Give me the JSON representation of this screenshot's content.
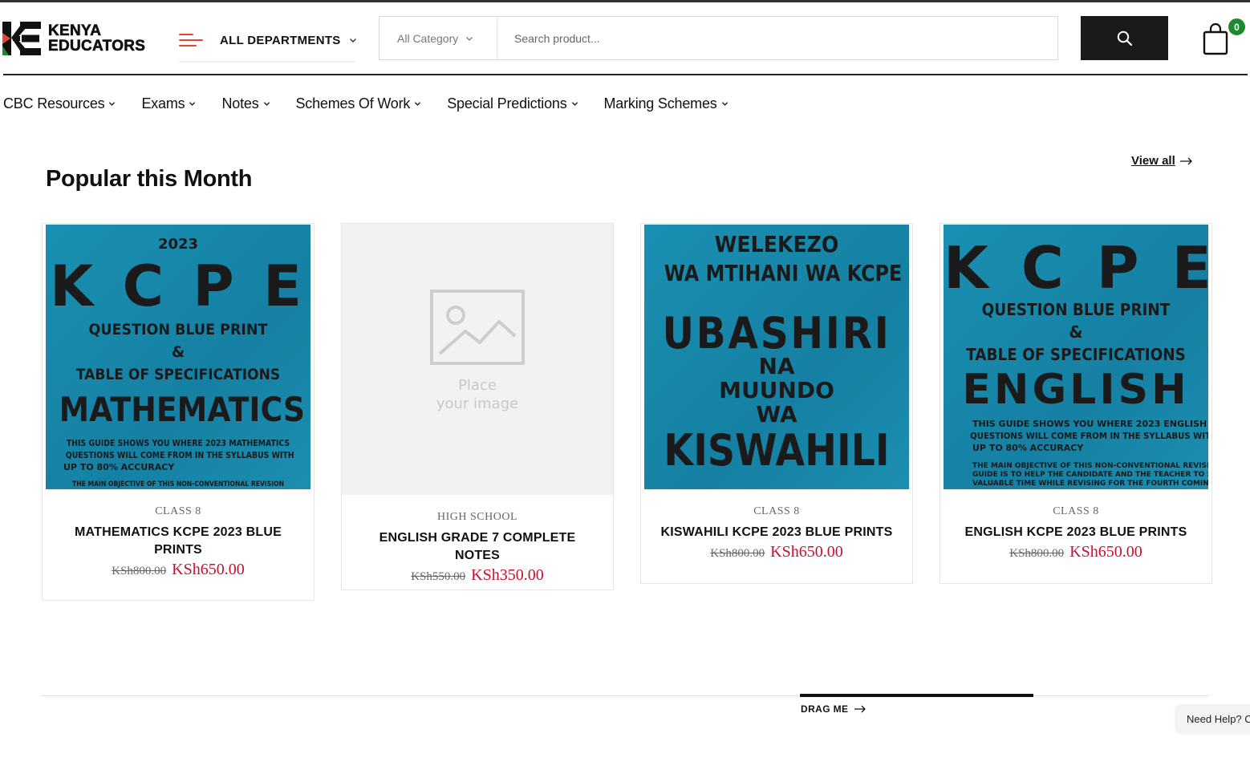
{
  "brand": {
    "name_line1": "KENYA",
    "name_line2": "EDUCATORS",
    "accent_red": "#e0492f",
    "accent_green": "#1e8a2e"
  },
  "header": {
    "departments_label": "ALL DEPARTMENTS",
    "search": {
      "category_label": "All Category",
      "placeholder": "Search product...",
      "value": ""
    },
    "cart_count": "0"
  },
  "nav": {
    "items": [
      {
        "label": "CBC Resources"
      },
      {
        "label": "Exams"
      },
      {
        "label": "Notes"
      },
      {
        "label": "Schemes Of Work"
      },
      {
        "label": "Special Predictions"
      },
      {
        "label": "Marking Schemes"
      }
    ]
  },
  "section": {
    "title": "Popular this Month",
    "view_all": "View all"
  },
  "products": [
    {
      "category": "CLASS 8",
      "title": "MATHEMATICS KCPE 2023 BLUE PRINTS",
      "old_price": "KSh800.00",
      "new_price": "KSh650.00",
      "cover": {
        "year": "2023",
        "big": "K C P E",
        "line1": "QUESTION BLUE PRINT",
        "amp": "&",
        "line2": "TABLE OF SPECIFICATIONS",
        "subject": "MATHEMATICS",
        "blurb1": "THIS GUIDE SHOWS YOU WHERE 2023 MATHEMATICS",
        "blurb2": "QUESTIONS WILL COME FROM IN THE SYLLABUS WITH",
        "blurb3": "UP TO 80% ACCURACY",
        "blurb4": "THE MAIN OBJECTIVE OF THIS NON-CONVENTIONAL REVISION"
      }
    },
    {
      "category": "HIGH SCHOOL",
      "title": "ENGLISH GRADE 7 COMPLETE NOTES",
      "old_price": "KSh550.00",
      "new_price": "KSh350.00",
      "placeholder_line1": "Place",
      "placeholder_line2": "your image"
    },
    {
      "category": "CLASS 8",
      "title": "KISWAHILI KCPE 2023 BLUE PRINTS",
      "old_price": "KSh800.00",
      "new_price": "KSh650.00",
      "cover": {
        "line1": "WELEKEZO",
        "line2": "WA MTIHANI WA KCPE",
        "big": "UBASHIRI",
        "na": "NA",
        "muundo": "MUUNDO",
        "wa": "WA",
        "subject": "KISWAHILI"
      }
    },
    {
      "category": "CLASS 8",
      "title": "ENGLISH KCPE 2023 BLUE PRINTS",
      "old_price": "KSh800.00",
      "new_price": "KSh650.00",
      "cover": {
        "big": "K C P E",
        "line1": "QUESTION BLUE PRINT",
        "amp": "&",
        "line2": "TABLE OF SPECIFICATIONS",
        "subject": "ENGLISH",
        "blurb1": "THIS GUIDE SHOWS YOU WHERE 2023 ENGLISH",
        "blurb2": "QUESTIONS WILL COME FROM IN THE SYLLABUS WITH",
        "blurb3": "UP TO 80% ACCURACY",
        "blurb4": "THE MAIN OBJECTIVE OF THIS NON-CONVENTIONAL REVISION",
        "blurb5": "GUIDE IS TO HELP THE CANDIDATE AND THE TEACHER TO SAVE",
        "blurb6": "VALUABLE TIME WHILE REVISING FOR THE FOURTH COMING"
      }
    }
  ],
  "carousel": {
    "drag_label": "DRAG ME"
  },
  "help_widget": {
    "label": "Need Help? Ch"
  }
}
